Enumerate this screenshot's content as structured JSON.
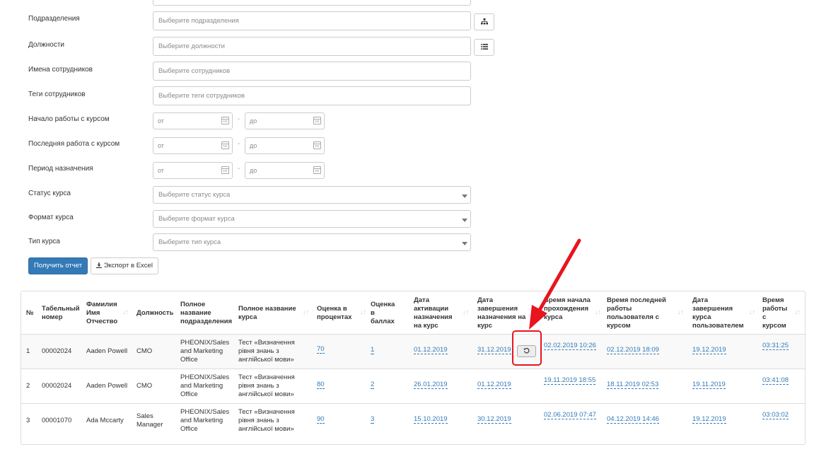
{
  "filters": {
    "departments": {
      "label": "Подразделения",
      "placeholder": "Выберите подразделения",
      "button_icon": "hierarchy-icon"
    },
    "positions": {
      "label": "Должности",
      "placeholder": "Выберите должности",
      "button_icon": "list-icon"
    },
    "employee_names": {
      "label": "Имена сотрудников",
      "placeholder": "Выберите сотрудников"
    },
    "employee_tags": {
      "label": "Теги сотрудников",
      "placeholder": "Выберите теги сотрудников"
    },
    "course_start": {
      "label": "Начало работы с курсом",
      "from": "от",
      "to": "до"
    },
    "course_last": {
      "label": "Последняя работа с курсом",
      "from": "от",
      "to": "до"
    },
    "assign_period": {
      "label": "Период назначения",
      "from": "от",
      "to": "до"
    },
    "course_status": {
      "label": "Статус курса",
      "placeholder": "Выберите статус курса"
    },
    "course_format": {
      "label": "Формат курса",
      "placeholder": "Выберите формат курса"
    },
    "course_type": {
      "label": "Тип курса",
      "placeholder": "Выберите тип курса"
    },
    "date_separator": "-"
  },
  "actions": {
    "report_label": "Получить отчет",
    "export_label": "Экспорт в Excel",
    "export_icon": "download-icon"
  },
  "table": {
    "headers": {
      "num": "№",
      "tab": "Табельный номер",
      "fio": "Фамилия Имя Отчество",
      "pos": "Должность",
      "dept": "Полное название подразделения",
      "course": "Полное название курса",
      "pct": "Оценка в процентах",
      "pts": "Оценка в баллах",
      "activ": "Дата активации назначения на курс",
      "endassign": "Дата завершения назначения на курс",
      "start": "Время начала прохождения курса",
      "last": "Время последней работы пользователя с курсом",
      "endcourse": "Дата завершения курса пользователем",
      "worktime": "Время работы с курсом"
    },
    "rows": [
      {
        "num": "1",
        "tab": "00002024",
        "fio": "Aaden Powell",
        "pos": "CMO",
        "dept": "PHEONIX/Sales and Marketing Office",
        "course": "Тест «Визначення рівня знань з англійської мови»",
        "pct": "70",
        "pts": "1",
        "activ": "01.12.2019",
        "endassign": "31.12.2019",
        "start": "02.02.2019 10:26",
        "last": "02.12.2019 18:09",
        "endcourse": "19.12.2019",
        "worktime": "03:31:25"
      },
      {
        "num": "2",
        "tab": "00002024",
        "fio": "Aaden Powell",
        "pos": "CMO",
        "dept": "PHEONIX/Sales and Marketing Office",
        "course": "Тест «Визначення рівня знань з англійської мови»",
        "pct": "80",
        "pts": "2",
        "activ": "26.01.2019",
        "endassign": "01.12.2019",
        "start": "19.11.2019 18:55",
        "last": "18.11.2019 02:53",
        "endcourse": "19.11.2019",
        "worktime": "03:41:08"
      },
      {
        "num": "3",
        "tab": "00001070",
        "fio": "Ada Mccarty",
        "pos": "Sales Manager",
        "dept": "PHEONIX/Sales and Marketing Office",
        "course": "Тест «Визначення рівня знань з англійської мови»",
        "pct": "90",
        "pts": "3",
        "activ": "15.10.2019",
        "endassign": "30.12.2019",
        "start": "02.06.2019 07:47",
        "last": "04.12.2019 14:46",
        "endcourse": "19.12.2019",
        "worktime": "03:03:02"
      }
    ],
    "reset_icon": "reset-icon"
  },
  "annotation": {
    "color": "#e8141e"
  }
}
